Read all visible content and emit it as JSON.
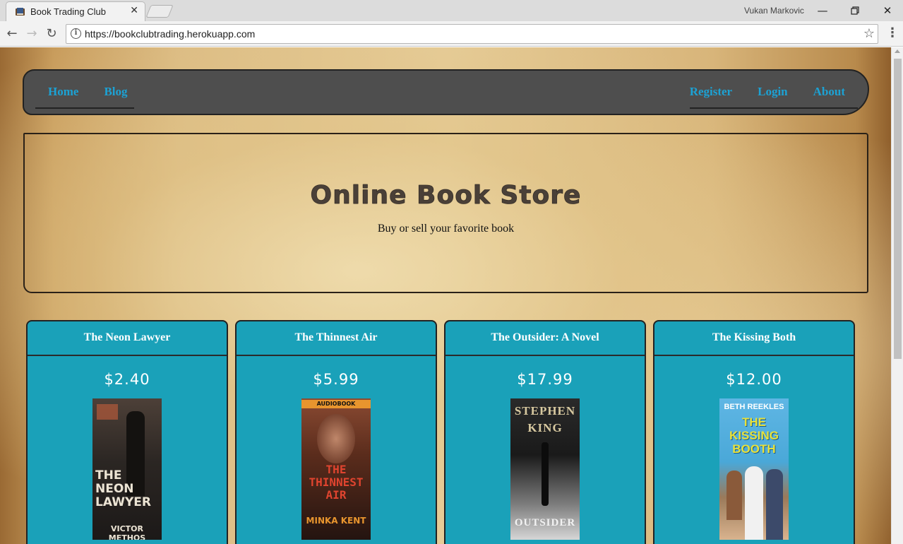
{
  "browser": {
    "tab_title": "Book Trading Club",
    "tab_close": "✕",
    "profile_name": "Vukan Markovic",
    "url": "https://bookclubtrading.herokuapp.com"
  },
  "nav": {
    "left": [
      {
        "label": "Home"
      },
      {
        "label": "Blog"
      }
    ],
    "right": [
      {
        "label": "Register"
      },
      {
        "label": "Login"
      },
      {
        "label": "About"
      }
    ]
  },
  "hero": {
    "title": "Online Book Store",
    "subtitle": "Buy or sell your favorite book"
  },
  "books": [
    {
      "title": "The Neon Lawyer",
      "price": "$2.40",
      "cover": {
        "top": "",
        "middle": "THE NEON LAWYER",
        "bottom": "VICTOR METHOS",
        "bg": "#2b2623",
        "accent": "#e9e1d2"
      }
    },
    {
      "title": "The Thinnest Air",
      "price": "$5.99",
      "cover": {
        "top": "AUDIOBOOK",
        "middle": "THE THINNEST AIR",
        "bottom": "MINKA KENT",
        "bg": "#3a1f17",
        "accent": "#e0442f"
      }
    },
    {
      "title": "The Outsider: A Novel",
      "price": "$17.99",
      "cover": {
        "top": "STEPHEN KING",
        "middle": "",
        "bottom": "OUTSIDER",
        "bg": "#1e1e1e",
        "accent": "#d8d2bf"
      }
    },
    {
      "title": "The Kissing Both",
      "price": "$12.00",
      "cover": {
        "top": "BETH REEKLES",
        "middle": "THE KISSING BOOTH",
        "bottom": "",
        "bg": "#4aa8d8",
        "accent": "#e8e13a"
      }
    }
  ]
}
